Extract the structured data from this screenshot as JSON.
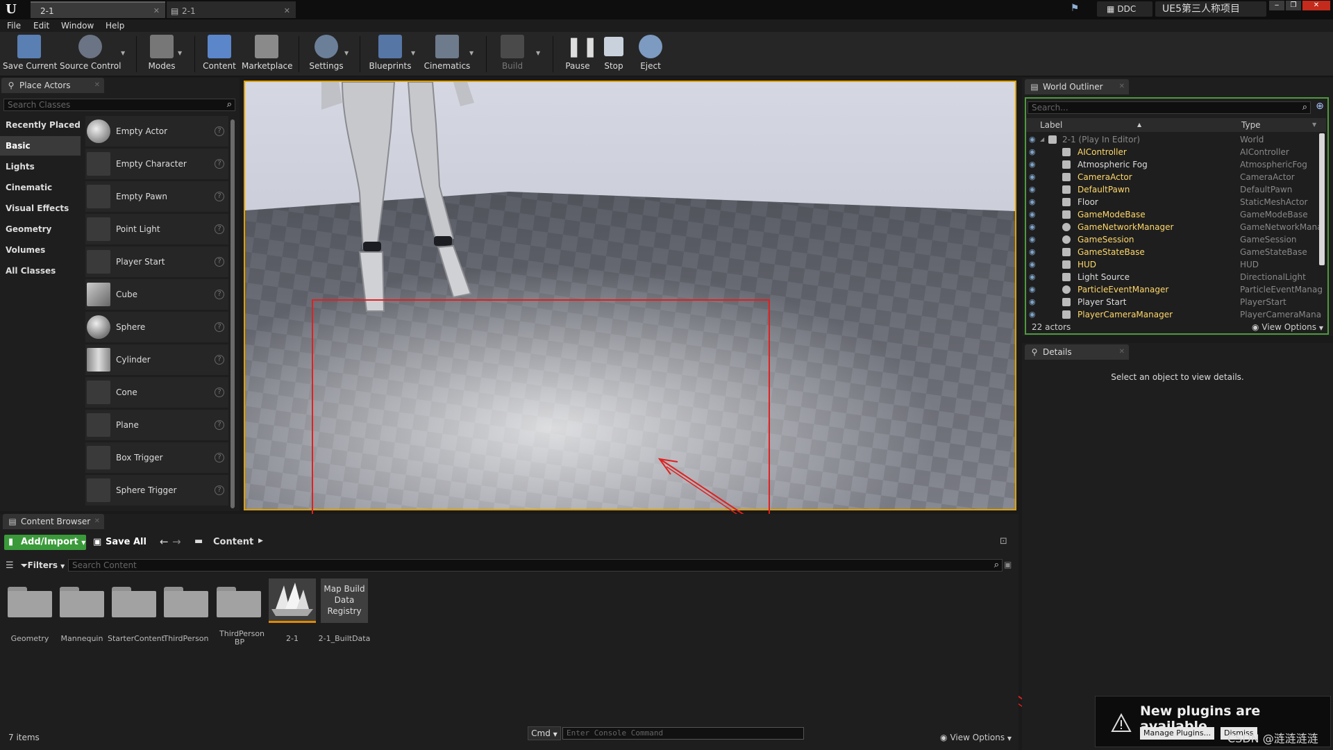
{
  "titlebar": {
    "tabs": [
      {
        "label": "2-1"
      },
      {
        "label": "2-1"
      }
    ],
    "ddc_label": "DDC",
    "project_name": "UE5第三人称项目"
  },
  "menu": [
    "File",
    "Edit",
    "Window",
    "Help"
  ],
  "toolbar": [
    {
      "label": "Save Current",
      "icon": "save-icon"
    },
    {
      "label": "Source Control",
      "icon": "source-control-icon"
    },
    {
      "label": "Modes",
      "icon": "modes-icon"
    },
    {
      "label": "Content",
      "icon": "content-icon"
    },
    {
      "label": "Marketplace",
      "icon": "marketplace-icon"
    },
    {
      "label": "Settings",
      "icon": "settings-icon"
    },
    {
      "label": "Blueprints",
      "icon": "blueprints-icon"
    },
    {
      "label": "Cinematics",
      "icon": "cinematics-icon"
    },
    {
      "label": "Build",
      "icon": "build-icon"
    },
    {
      "label": "Pause",
      "icon": "pause-icon"
    },
    {
      "label": "Stop",
      "icon": "stop-icon"
    },
    {
      "label": "Eject",
      "icon": "eject-icon"
    }
  ],
  "place_actors": {
    "tab_label": "Place Actors",
    "search_placeholder": "Search Classes",
    "categories": [
      "Recently Placed",
      "Basic",
      "Lights",
      "Cinematic",
      "Visual Effects",
      "Geometry",
      "Volumes",
      "All Classes"
    ],
    "items": [
      "Empty Actor",
      "Empty Character",
      "Empty Pawn",
      "Point Light",
      "Player Start",
      "Cube",
      "Sphere",
      "Cylinder",
      "Cone",
      "Plane",
      "Box Trigger",
      "Sphere Trigger"
    ]
  },
  "outliner": {
    "tab_label": "World Outliner",
    "search_placeholder": "Search...",
    "col_label": "Label",
    "col_type": "Type",
    "rows": [
      {
        "label": "2-1 (Play In Editor)",
        "type": "World"
      },
      {
        "label": "AIController",
        "type": "AIController"
      },
      {
        "label": "Atmospheric Fog",
        "type": "AtmosphericFog"
      },
      {
        "label": "CameraActor",
        "type": "CameraActor"
      },
      {
        "label": "DefaultPawn",
        "type": "DefaultPawn"
      },
      {
        "label": "Floor",
        "type": "StaticMeshActor"
      },
      {
        "label": "GameModeBase",
        "type": "GameModeBase"
      },
      {
        "label": "GameNetworkManager",
        "type": "GameNetworkManager"
      },
      {
        "label": "GameSession",
        "type": "GameSession"
      },
      {
        "label": "GameStateBase",
        "type": "GameStateBase"
      },
      {
        "label": "HUD",
        "type": "HUD"
      },
      {
        "label": "Light Source",
        "type": "DirectionalLight"
      },
      {
        "label": "ParticleEventManager",
        "type": "ParticleEventManager"
      },
      {
        "label": "Player Start",
        "type": "PlayerStart"
      },
      {
        "label": "PlayerCameraManager",
        "type": "PlayerCameraManager"
      }
    ],
    "actor_count": "22 actors",
    "view_options": "View Options"
  },
  "details": {
    "tab_label": "Details",
    "empty_text": "Select an object to view details."
  },
  "content_browser": {
    "tab_label": "Content Browser",
    "add_import": "Add/Import",
    "save_all": "Save All",
    "path_label": "Content",
    "filters": "Filters",
    "search_placeholder": "Search Content",
    "assets": [
      "Geometry",
      "Mannequin",
      "StarterContent",
      "ThirdPerson",
      "ThirdPerson BP",
      "2-1",
      "2-1_BuiltData"
    ],
    "map_build_thumb": "Map Build Data Registry",
    "item_count": "7 items",
    "cmd_label": "Cmd",
    "console_placeholder": "Enter Console Command",
    "view_options": "View Options"
  },
  "notification": {
    "title": "New plugins are available",
    "manage_btn": "Manage Plugins...",
    "dismiss_btn": "Dismiss"
  },
  "watermark": "CSDN @涟涟涟涟",
  "colors": {
    "accent_selection": "#e0a100",
    "outliner_highlight": "#4e9a3e",
    "annotation": "#e02020",
    "add_import_green": "#3a9a3a"
  }
}
